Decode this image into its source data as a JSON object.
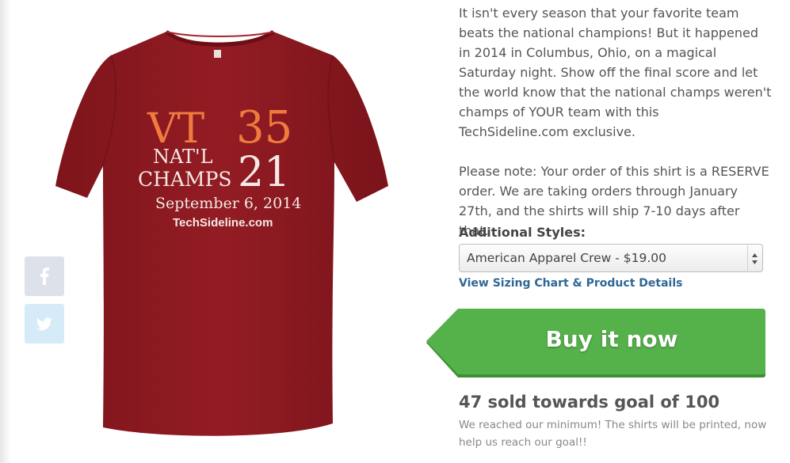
{
  "product": {
    "shirt_image": {
      "alt": "Maroon t-shirt",
      "color": "#8e1a22",
      "print": {
        "line1_left": "VT",
        "line1_right": "35",
        "line2_left": "NAT'L",
        "line3_left": "CHAMPS",
        "line23_right": "21",
        "date": "September 6, 2014",
        "site": "TechSideline.com",
        "accent_color": "#ef7b3e",
        "text_color": "#f4e9e4"
      }
    },
    "description": [
      "It isn't every season that your favorite team beats the national champions! But it happened in 2014 in Columbus, Ohio, on a magical Saturday night. Show off the final score and let the world know that the national champs weren't champs of YOUR team with this TechSideline.com exclusive.",
      "Please note: Your order of this shirt is a RESERVE order. We are taking orders through January 27th, and the shirts will ship 7-10 days after that."
    ],
    "styles": {
      "label": "Additional Styles:",
      "selected": "American Apparel Crew - $19.00"
    },
    "sizing_link": "View Sizing Chart & Product Details",
    "buy_button": {
      "label": "Buy it now",
      "color": "#55b14a"
    },
    "campaign": {
      "sold": 47,
      "goal": 100,
      "sold_text": "47 sold towards goal of 100",
      "note": "We reached our minimum! The shirts will be printed, now help us reach our goal!!"
    }
  },
  "social": [
    {
      "icon": "facebook-icon"
    },
    {
      "icon": "twitter-icon"
    }
  ]
}
